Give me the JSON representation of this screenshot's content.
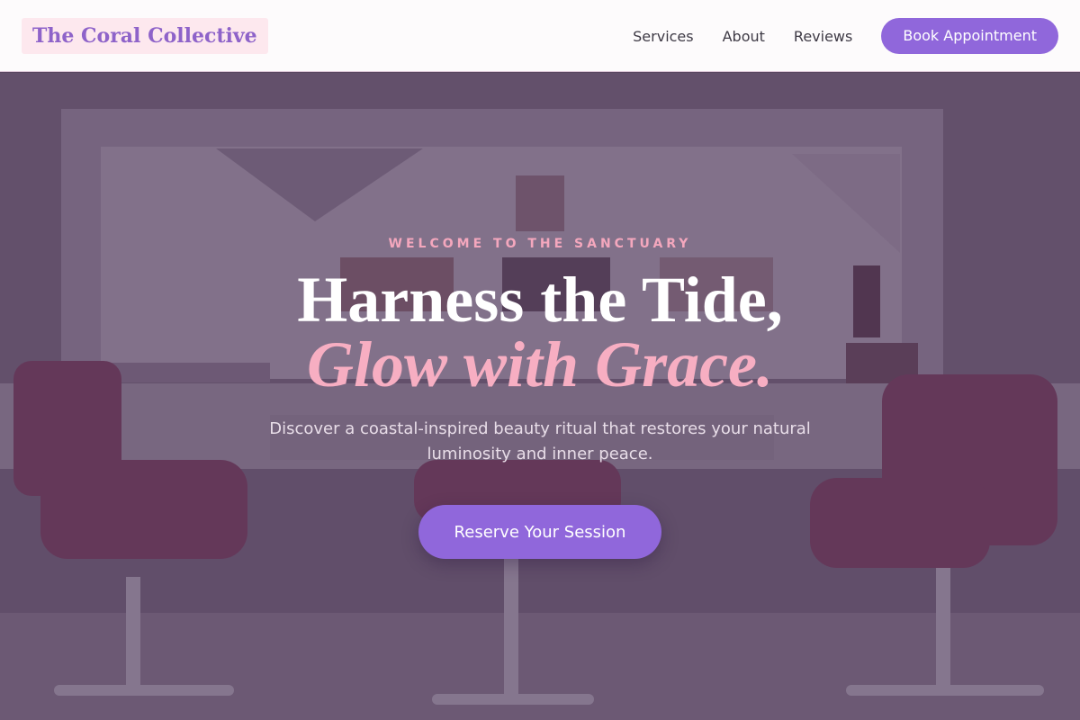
{
  "header": {
    "logo": "The Coral Collective",
    "nav": [
      {
        "label": "Services"
      },
      {
        "label": "About"
      },
      {
        "label": "Reviews"
      }
    ],
    "book_button": "Book Appointment"
  },
  "hero": {
    "eyebrow": "WELCOME TO THE SANCTUARY",
    "title_line1": "Harness the Tide,",
    "title_line2": "Glow with Grace.",
    "subtitle": "Discover a coastal-inspired beauty ritual that restores your natural luminosity and inner peace.",
    "cta": "Reserve Your Session"
  },
  "colors": {
    "accent": "#9067db",
    "logo_text": "#8e63c9",
    "logo_bg": "#fde8ee",
    "eyebrow": "#f4a7bd",
    "title_italic": "#f7aec2"
  }
}
